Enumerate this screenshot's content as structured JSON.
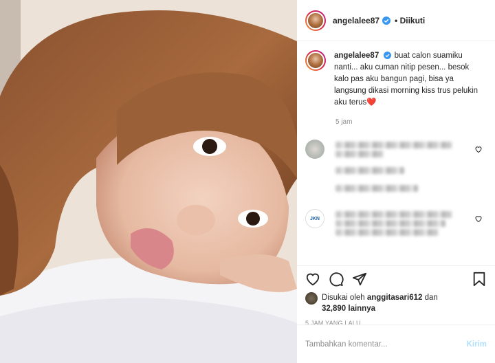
{
  "post": {
    "username": "angelalee87",
    "follow_status": "Diikuti",
    "caption": "buat calon suamiku nanti... aku cuman nitip pesen... besok kalo pas aku bangun pagi, bisa ya langsung dikasi morning kiss trus pelukin aku terus",
    "caption_emoji": "❤️",
    "caption_time": "5 jam",
    "comment_avatar_2_label": "JKN"
  },
  "likes": {
    "prefix": "Disukai oleh",
    "user": "anggitasari612",
    "conjunction": "dan",
    "count": "32,890 lainnya"
  },
  "timestamp": "5 JAM YANG LALU",
  "comment_box": {
    "placeholder": "Tambahkan komentar...",
    "post_label": "Kirim"
  },
  "colors": {
    "verified": "#3897f0",
    "heart": "#ed4956",
    "post_button": "#b2dffc"
  },
  "icons": [
    "heart-icon",
    "comment-icon",
    "share-icon",
    "bookmark-icon",
    "verified-icon"
  ]
}
